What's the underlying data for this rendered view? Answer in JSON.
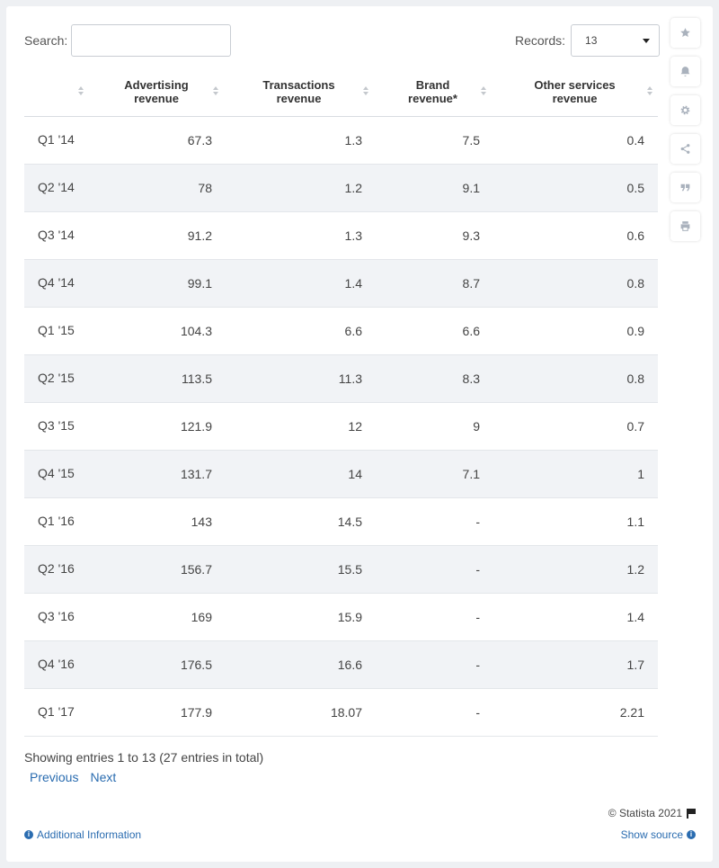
{
  "controls": {
    "search_label": "Search:",
    "search_value": "",
    "records_label": "Records:",
    "records_value": "13"
  },
  "sidebar": {
    "icons": [
      "star-icon",
      "bell-icon",
      "gear-icon",
      "share-icon",
      "quote-icon",
      "print-icon"
    ]
  },
  "chart_data": {
    "type": "table",
    "columns": [
      "",
      "Advertising revenue",
      "Transactions revenue",
      "Brand revenue*",
      "Other services revenue"
    ],
    "rows": [
      [
        "Q1 '14",
        "67.3",
        "1.3",
        "7.5",
        "0.4"
      ],
      [
        "Q2 '14",
        "78",
        "1.2",
        "9.1",
        "0.5"
      ],
      [
        "Q3 '14",
        "91.2",
        "1.3",
        "9.3",
        "0.6"
      ],
      [
        "Q4 '14",
        "99.1",
        "1.4",
        "8.7",
        "0.8"
      ],
      [
        "Q1 '15",
        "104.3",
        "6.6",
        "6.6",
        "0.9"
      ],
      [
        "Q2 '15",
        "113.5",
        "11.3",
        "8.3",
        "0.8"
      ],
      [
        "Q3 '15",
        "121.9",
        "12",
        "9",
        "0.7"
      ],
      [
        "Q4 '15",
        "131.7",
        "14",
        "7.1",
        "1"
      ],
      [
        "Q1 '16",
        "143",
        "14.5",
        "-",
        "1.1"
      ],
      [
        "Q2 '16",
        "156.7",
        "15.5",
        "-",
        "1.2"
      ],
      [
        "Q3 '16",
        "169",
        "15.9",
        "-",
        "1.4"
      ],
      [
        "Q4 '16",
        "176.5",
        "16.6",
        "-",
        "1.7"
      ],
      [
        "Q1 '17",
        "177.9",
        "18.07",
        "-",
        "2.21"
      ]
    ]
  },
  "footer": {
    "entries_text": "Showing entries 1 to 13 (27 entries in total)",
    "previous_label": "Previous",
    "next_label": "Next",
    "copyright": "© Statista 2021",
    "additional_info": "Additional Information",
    "show_source": "Show source"
  }
}
